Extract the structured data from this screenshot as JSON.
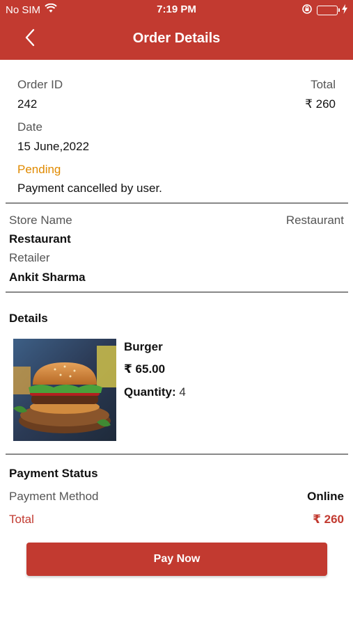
{
  "status_bar": {
    "carrier": "No SIM",
    "time": "7:19 PM"
  },
  "nav": {
    "title": "Order Details"
  },
  "order": {
    "id_label": "Order ID",
    "id_value": "242",
    "total_label": "Total",
    "total_value": "₹ 260",
    "date_label": "Date",
    "date_value": "15 June,2022",
    "status": "Pending",
    "status_message": "Payment cancelled by user."
  },
  "store": {
    "name_label": "Store Name",
    "type_value": "Restaurant",
    "name_value": "Restaurant",
    "retailer_label": "Retailer",
    "retailer_value": "Ankit Sharma"
  },
  "details": {
    "heading": "Details",
    "item_name": "Burger",
    "item_price": "₹ 65.00",
    "quantity_label": "Quantity:",
    "quantity_value": "4"
  },
  "payment": {
    "heading": "Payment Status",
    "method_label": "Payment Method",
    "method_value": "Online",
    "total_label": "Total",
    "total_value": "₹ 260"
  },
  "actions": {
    "pay_now": "Pay Now"
  },
  "colors": {
    "brand": "#c23a30",
    "pending": "#e08a00",
    "battery": "#4cd964"
  }
}
